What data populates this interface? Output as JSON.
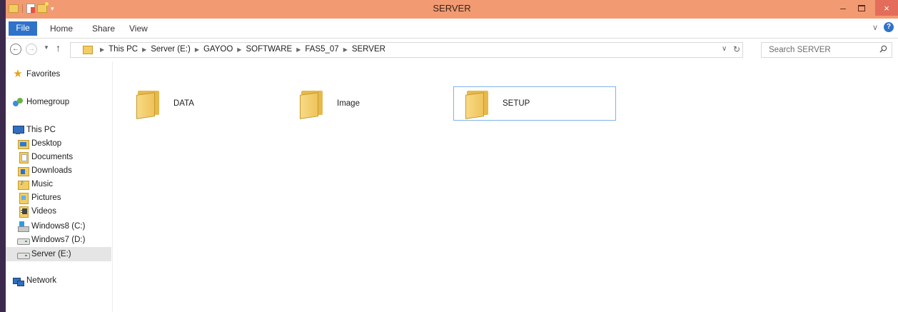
{
  "window": {
    "title": "SERVER",
    "close_glyph": "×",
    "min_glyph": "–"
  },
  "ribbon": {
    "tabs": [
      {
        "label": "File"
      },
      {
        "label": "Home"
      },
      {
        "label": "Share"
      },
      {
        "label": "View"
      }
    ],
    "help_glyph": "?"
  },
  "address": {
    "crumbs": [
      "This PC",
      "Server (E:)",
      "GAYOO",
      "SOFTWARE",
      "FAS5_07",
      "SERVER"
    ]
  },
  "search": {
    "placeholder": "Search SERVER"
  },
  "navpane": {
    "favorites": "Favorites",
    "homegroup": "Homegroup",
    "this_pc": "This PC",
    "items": [
      {
        "label": "Desktop",
        "icon": "desktop-icon"
      },
      {
        "label": "Documents",
        "icon": "documents-icon"
      },
      {
        "label": "Downloads",
        "icon": "downloads-icon"
      },
      {
        "label": "Music",
        "icon": "music-icon"
      },
      {
        "label": "Pictures",
        "icon": "pictures-icon"
      },
      {
        "label": "Videos",
        "icon": "videos-icon"
      },
      {
        "label": "Windows8 (C:)",
        "icon": "drive-icon"
      },
      {
        "label": "Windows7 (D:)",
        "icon": "drive-icon"
      },
      {
        "label": "Server (E:)",
        "icon": "drive-icon",
        "selected": true
      }
    ],
    "network": "Network"
  },
  "content": {
    "folders": [
      {
        "name": "DATA"
      },
      {
        "name": "Image"
      },
      {
        "name": "SETUP",
        "selected": true
      }
    ]
  },
  "colors": {
    "titlebar": "#f29a72",
    "file_tab": "#2f72c9",
    "close_button": "#e36d5a",
    "selection_border": "#7eb4ea",
    "nav_selected": "#e5e5e5"
  }
}
